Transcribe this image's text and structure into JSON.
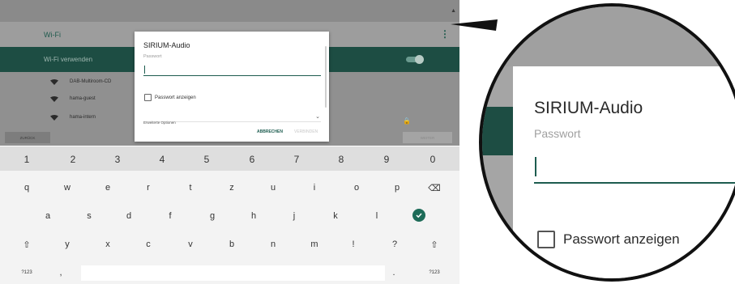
{
  "appbar": {
    "title": "Wi-Fi"
  },
  "wifi_toggle": {
    "label": "Wi-Fi verwenden",
    "enabled": true
  },
  "networks": [
    {
      "name": "DAB-Multiroom-CD",
      "secured": false
    },
    {
      "name": "hama-guest",
      "secured": false
    },
    {
      "name": "hama-intern",
      "secured": true
    }
  ],
  "buttons": {
    "back": "ZURÜCK",
    "next": "WEITER"
  },
  "dialog": {
    "title": "SIRIUM-Audio",
    "password_label": "Passwort",
    "password_value": "",
    "show_password_label": "Passwort anzeigen",
    "show_password_checked": false,
    "advanced_label": "Erweiterte Optionen",
    "cancel": "ABBRECHEN",
    "connect": "VERBINDEN"
  },
  "keyboard": {
    "numbers": [
      "1",
      "2",
      "3",
      "4",
      "5",
      "6",
      "7",
      "8",
      "9",
      "0"
    ],
    "row1": [
      "q",
      "w",
      "e",
      "r",
      "t",
      "z",
      "u",
      "i",
      "o",
      "p"
    ],
    "row2": [
      "a",
      "s",
      "d",
      "f",
      "g",
      "h",
      "j",
      "k",
      "l"
    ],
    "row3": [
      "y",
      "x",
      "c",
      "v",
      "b",
      "n",
      "m",
      "!",
      "?"
    ],
    "symbols_key": "?123",
    "comma": ",",
    "period": "."
  },
  "magnifier": {
    "title": "SIRIUM-Audio",
    "password_label": "Passwort",
    "show_password_label": "Passwort anzeigen"
  },
  "colors": {
    "accent": "#1d5c4f",
    "wifi_bar": "#1d4d43",
    "overlay": "#909090"
  }
}
